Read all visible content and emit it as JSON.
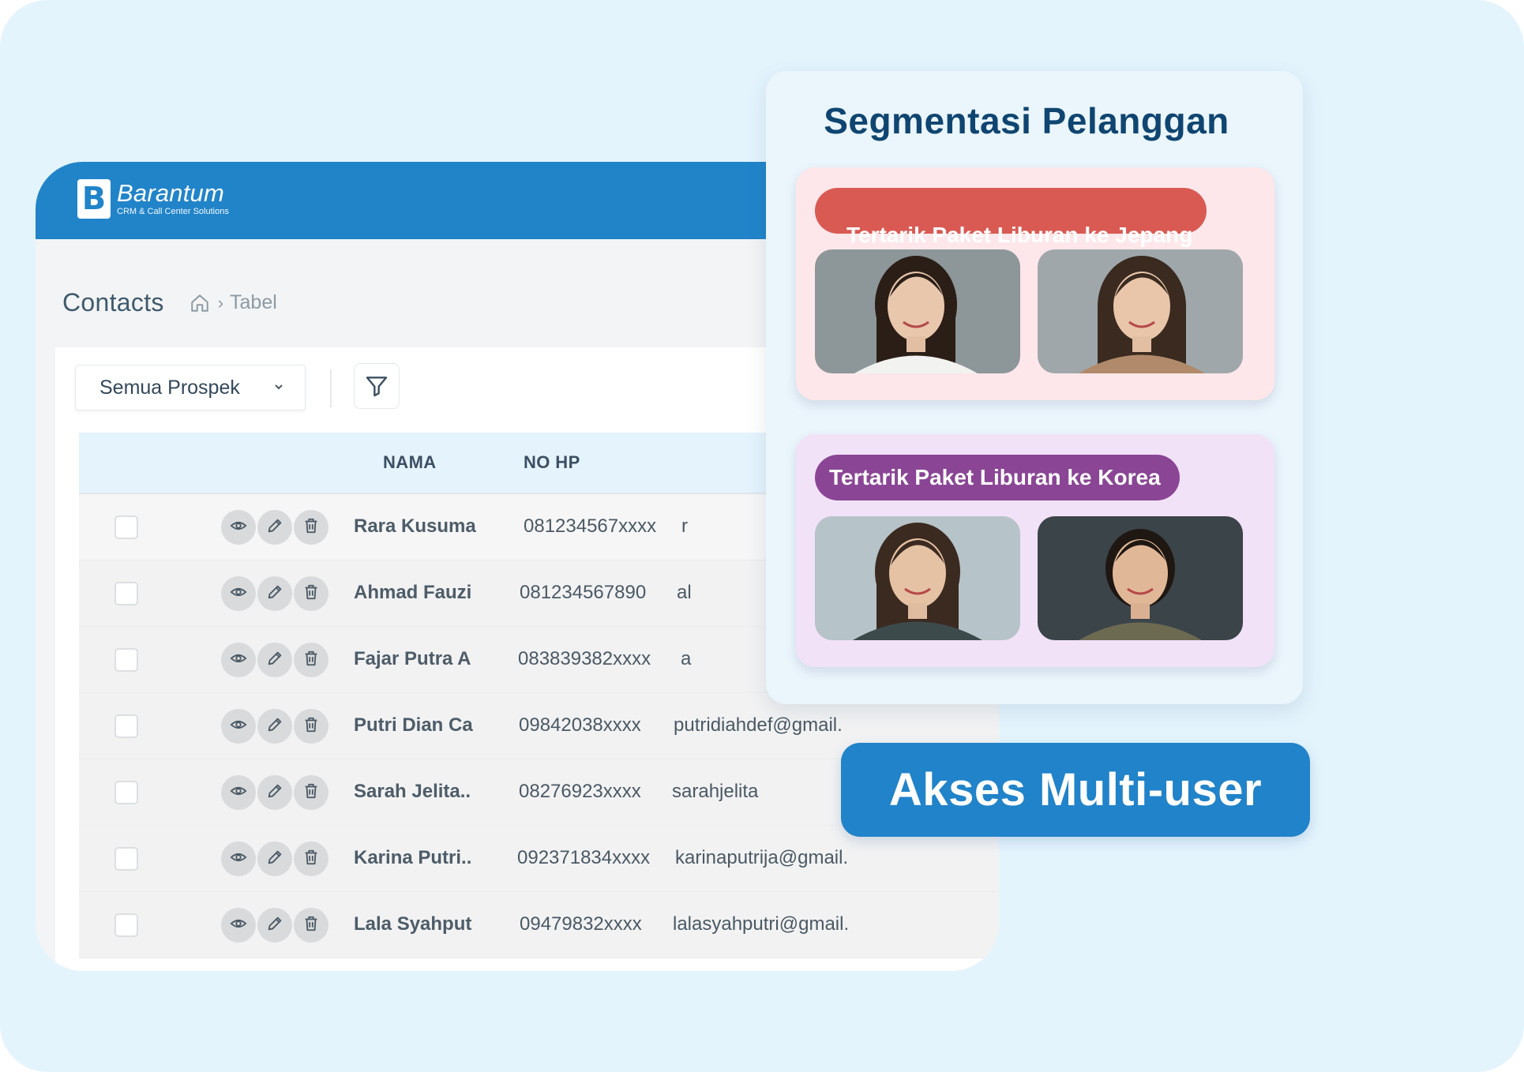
{
  "brand": {
    "name": "Barantum",
    "tagline": "CRM & Call Center Solutions",
    "logo_letter": "B"
  },
  "page": {
    "title": "Contacts",
    "breadcrumb_current": "Tabel"
  },
  "toolbar": {
    "filter_dropdown": "Semua Prospek"
  },
  "table": {
    "columns": [
      "NAMA",
      "NO HP"
    ],
    "rows": [
      {
        "name": "Rara Kusuma",
        "phone": "081234567xxxx",
        "email": "r"
      },
      {
        "name": "Ahmad Fauzi",
        "phone": "081234567890",
        "email": "al"
      },
      {
        "name": "Fajar Putra A",
        "phone": "083839382xxxx",
        "email": "a"
      },
      {
        "name": "Putri Dian Ca",
        "phone": "09842038xxxx",
        "email": "putridiahdef@gmail."
      },
      {
        "name": "Sarah Jelita..",
        "phone": "08276923xxxx",
        "email": "sarahjelita"
      },
      {
        "name": "Karina Putri..",
        "phone": "092371834xxxx",
        "email": "karinaputrija@gmail."
      },
      {
        "name": "Lala Syahput",
        "phone": "09479832xxxx",
        "email": "lalasyahputri@gmail."
      }
    ]
  },
  "segmentation": {
    "title": "Segmentasi Pelanggan",
    "groups": [
      {
        "label": "Tertarik Paket Liburan ke Jepang",
        "color": "#d95a53"
      },
      {
        "label": "Tertarik Paket Liburan ke Korea",
        "color": "#8a4595"
      }
    ]
  },
  "badge": {
    "label": "Akses Multi-user"
  },
  "colors": {
    "primary": "#2184c9",
    "background": "#e4f4fd"
  }
}
